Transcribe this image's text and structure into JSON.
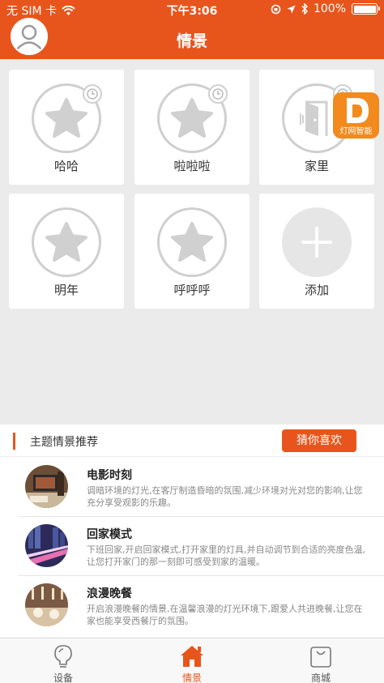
{
  "status": {
    "carrier": "无 SIM 卡",
    "time": "下午3:06",
    "battery": "100%"
  },
  "header": {
    "title": "情景"
  },
  "scenes": [
    {
      "label": "哈哈",
      "icon": "star-icon"
    },
    {
      "label": "啦啦啦",
      "icon": "star-icon"
    },
    {
      "label": "家里",
      "icon": "door-icon"
    },
    {
      "label": "明年",
      "icon": "star-icon"
    },
    {
      "label": "呼呼呼",
      "icon": "star-icon"
    },
    {
      "label": "添加",
      "icon": "plus-icon"
    }
  ],
  "badge": {
    "text": "灯网智能"
  },
  "recommend": {
    "title": "主题情景推荐",
    "button": "猜你喜欢",
    "items": [
      {
        "name": "电影时刻",
        "desc": "调暗环境的灯光,在客厅制造昏暗的氛围,减少环境对光对您的影响,让您充分享受观影的乐趣。"
      },
      {
        "name": "回家模式",
        "desc": "下班回家,开启回家模式,打开家里的灯具,并自动调节到合适的亮度色温,让您打开家门的那一刻即可感受到家的温暖。"
      },
      {
        "name": "浪漫晚餐",
        "desc": "开启浪漫晚餐的情景,在温馨浪漫的灯光环境下,跟爱人共进晚餐,让您在家也能享受西餐厅的氛围。"
      }
    ]
  },
  "tabs": [
    {
      "label": "设备",
      "icon": "bulb-icon"
    },
    {
      "label": "情景",
      "icon": "home-icon"
    },
    {
      "label": "商城",
      "icon": "bag-icon"
    }
  ],
  "colors": {
    "accent": "#e8551c",
    "background": "#ebebeb"
  }
}
